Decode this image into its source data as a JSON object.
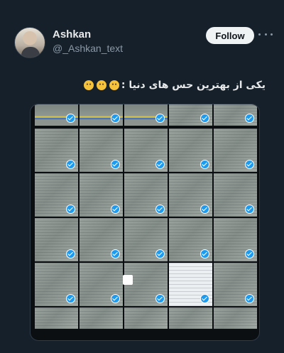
{
  "user": {
    "display_name": "Ashkan",
    "handle": "@_Ashkan_text",
    "avatar_icon": "profile-photo"
  },
  "actions": {
    "follow_label": "Follow",
    "more_icon": "more-horizontal-icon"
  },
  "tweet": {
    "text": "یکی از بهترین حس های دنیا :",
    "emojis": [
      "smiling-face-emoji",
      "grimacing-face-emoji",
      "grinning-face-emoji"
    ]
  },
  "media": {
    "type": "photo-grid",
    "rows": 6,
    "cols": 5,
    "check_icon": "checkmark-icon",
    "colors": {
      "check": "#1d9bf0",
      "background": "#15202b"
    }
  }
}
